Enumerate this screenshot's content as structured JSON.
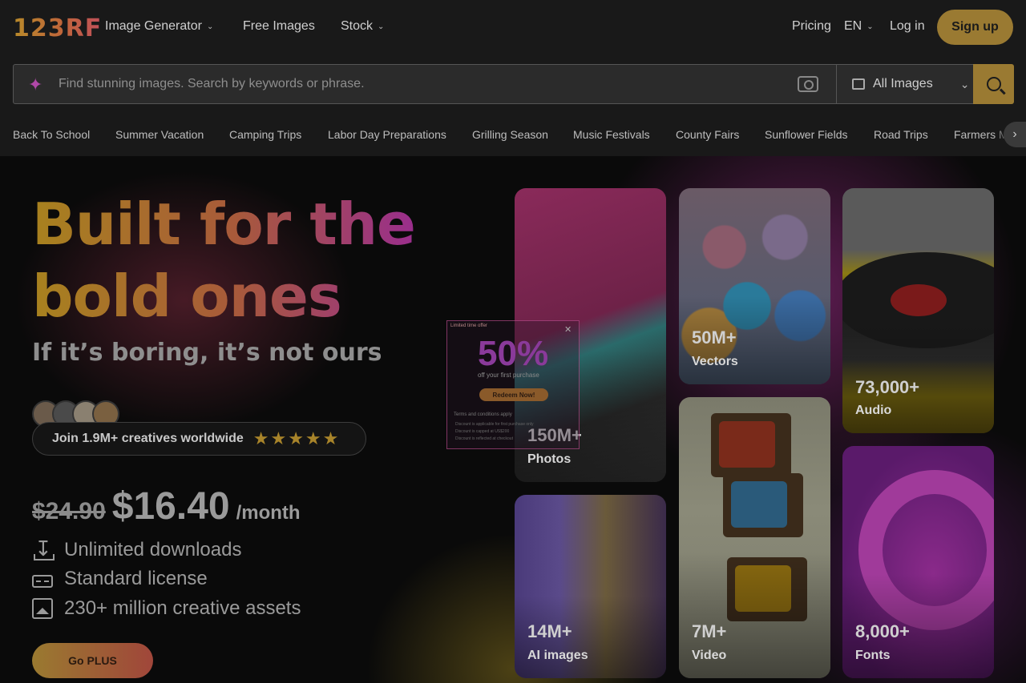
{
  "header": {
    "logo": "123RF",
    "nav": [
      {
        "label": "Image Generator",
        "has_dropdown": true
      },
      {
        "label": "Free Images",
        "has_dropdown": false
      },
      {
        "label": "Stock",
        "has_dropdown": true
      }
    ],
    "pricing": "Pricing",
    "language": "EN",
    "login": "Log in",
    "signup": "Sign up"
  },
  "search": {
    "placeholder": "Find stunning images. Search by keywords or phrase.",
    "filter": "All Images",
    "icons": [
      "sparkle-icon",
      "camera-icon",
      "image-icon",
      "search-icon"
    ]
  },
  "tags": [
    "Back To School",
    "Summer Vacation",
    "Camping Trips",
    "Labor Day Preparations",
    "Grilling Season",
    "Music Festivals",
    "County Fairs",
    "Sunflower Fields",
    "Road Trips",
    "Farmers Markets"
  ],
  "hero": {
    "headline_line1": "Built for the",
    "headline_line2": "bold ones",
    "subhead": "If it’s boring, it’s not ours",
    "social_proof": "Join 1.9M+ creatives worldwide",
    "rating_stars": 5,
    "stars_text": "★★★★★",
    "old_price": "$24.90",
    "new_price": "$16.40",
    "per": "/month",
    "features": [
      "Unlimited downloads",
      "Standard license",
      "230+ million creative assets"
    ],
    "cta": "Go PLUS"
  },
  "tiles": [
    {
      "count": "150M+",
      "label": "Photos"
    },
    {
      "count": "50M+",
      "label": "Vectors"
    },
    {
      "count": "73,000+",
      "label": "Audio"
    },
    {
      "count": "14M+",
      "label": "AI images"
    },
    {
      "count": "7M+",
      "label": "Video"
    },
    {
      "count": "8,000+",
      "label": "Fonts"
    }
  ],
  "promo": {
    "badge": "Limited time offer",
    "discount": "50%",
    "subtitle": "off your first purchase",
    "button": "Redeem Now!",
    "terms_title": "Terms and conditions apply",
    "terms": [
      "Discount is applicable for first purchase only",
      "Discount is capped at US$200",
      "Discount is reflected at checkout"
    ]
  },
  "colors": {
    "accent": "#9a7a32",
    "background": "#0a0a0a",
    "header": "#191919"
  }
}
